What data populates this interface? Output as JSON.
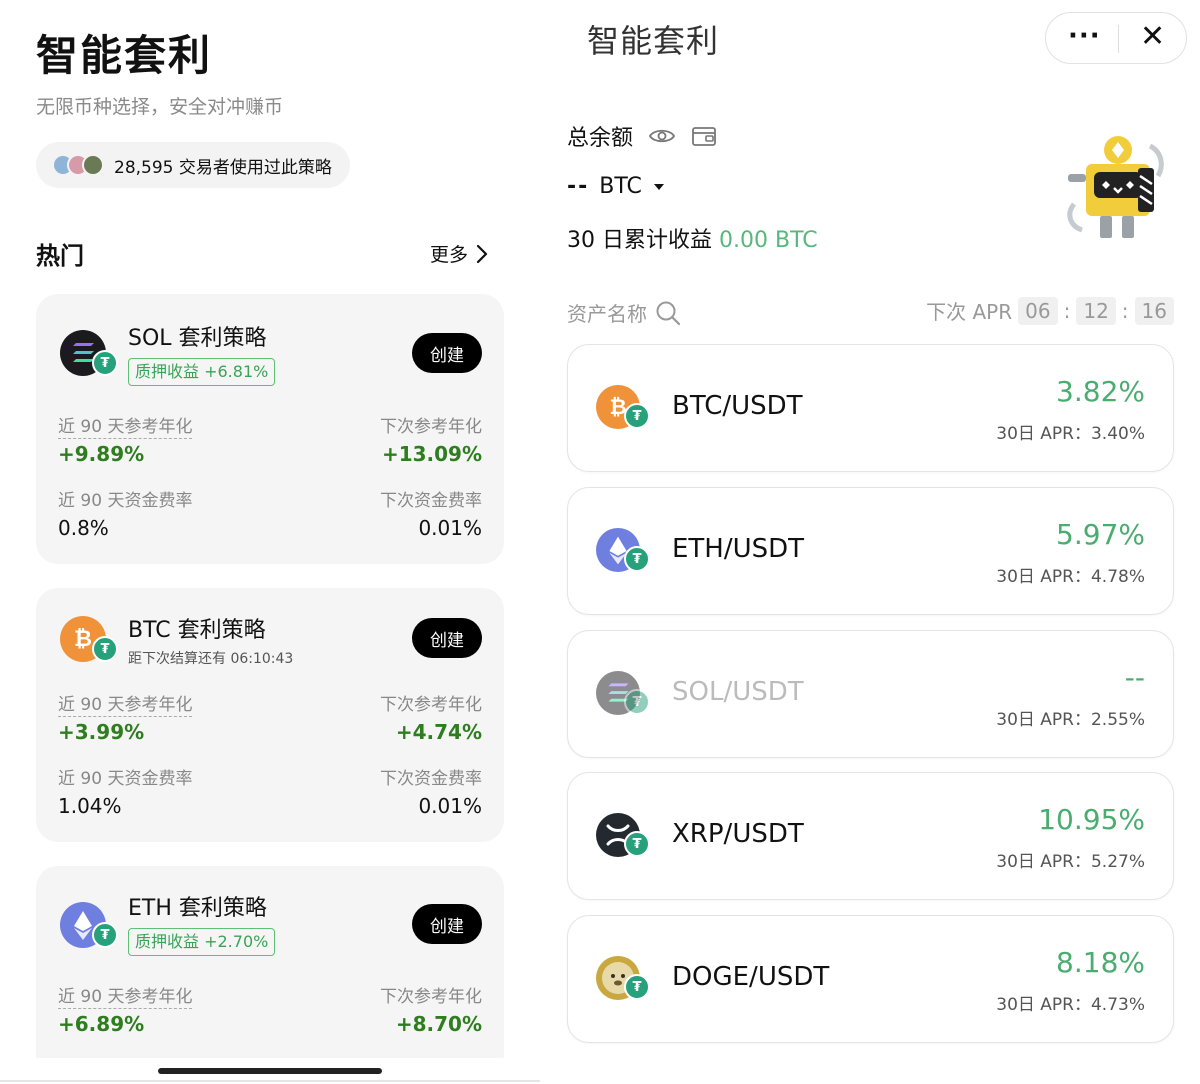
{
  "left": {
    "title": "智能套利",
    "subtitle": "无限币种选择，安全对冲赚币",
    "users_text": "28,595 交易者使用过此策略",
    "hot_title": "热门",
    "more_label": "更多",
    "cards": [
      {
        "name": "SOL 套利策略",
        "tag": "质押收益 +6.81%",
        "create_label": "创建",
        "m1_label": "近 90 天参考年化",
        "m1_value": "+9.89%",
        "m2_label": "下次参考年化",
        "m2_value": "+13.09%",
        "m3_label": "近 90 天资金费率",
        "m3_value": "0.8%",
        "m4_label": "下次资金费率",
        "m4_value": "0.01%"
      },
      {
        "name": "BTC 套利策略",
        "note": "距下次结算还有 06:10:43",
        "create_label": "创建",
        "m1_label": "近 90 天参考年化",
        "m1_value": "+3.99%",
        "m2_label": "下次参考年化",
        "m2_value": "+4.74%",
        "m3_label": "近 90 天资金费率",
        "m3_value": "1.04%",
        "m4_label": "下次资金费率",
        "m4_value": "0.01%"
      },
      {
        "name": "ETH 套利策略",
        "tag": "质押收益 +2.70%",
        "create_label": "创建",
        "m1_label": "近 90 天参考年化",
        "m1_value": "+6.89%",
        "m2_label": "下次参考年化",
        "m2_value": "+8.70%"
      }
    ]
  },
  "right": {
    "title": "智能套利",
    "balance_label": "总余额",
    "balance_value": "--",
    "balance_unit": "BTC",
    "profit_label": "30 日累计收益",
    "profit_value": "0.00 BTC",
    "col_asset": "资产名称",
    "col_next_apr": "下次 APR",
    "countdown": [
      "06",
      "12",
      "16"
    ],
    "apr30_label": "30日 APR：",
    "rows": [
      {
        "pair": "BTC/USDT",
        "pct": "3.82%",
        "apr30": "3.40%"
      },
      {
        "pair": "ETH/USDT",
        "pct": "5.97%",
        "apr30": "4.78%"
      },
      {
        "pair": "SOL/USDT",
        "pct": "--",
        "apr30": "2.55%"
      },
      {
        "pair": "XRP/USDT",
        "pct": "10.95%",
        "apr30": "5.27%"
      },
      {
        "pair": "DOGE/USDT",
        "pct": "8.18%",
        "apr30": "4.73%"
      }
    ]
  },
  "colors": {
    "accent_green": "#4aad6f",
    "dark_green": "#2e7d1e",
    "tether": "#26a17b",
    "btc": "#f0923a",
    "eth": "#6f7fe0",
    "sol": "#1b1b1f",
    "xrp": "#23292f",
    "doge": "#c9a840"
  }
}
